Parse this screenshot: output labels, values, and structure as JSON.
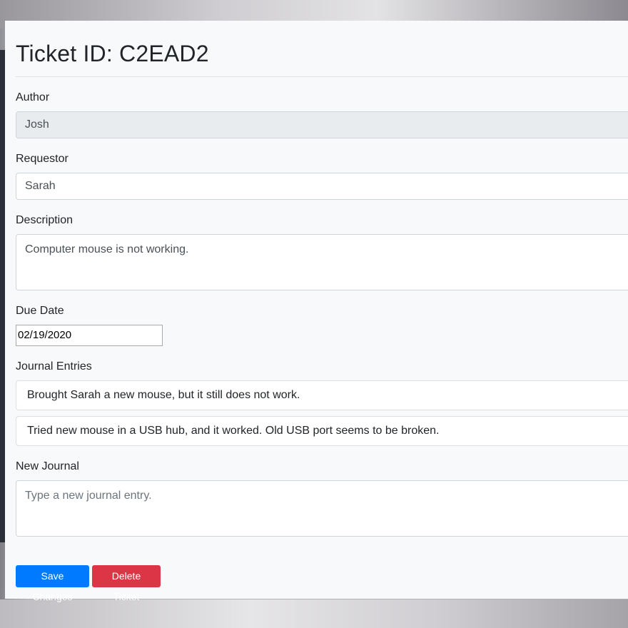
{
  "ticket": {
    "title": "Ticket ID: C2EAD2"
  },
  "form": {
    "author": {
      "label": "Author",
      "value": "Josh"
    },
    "requestor": {
      "label": "Requestor",
      "value": "Sarah"
    },
    "description": {
      "label": "Description",
      "value": "Computer mouse is not working."
    },
    "due_date": {
      "label": "Due Date",
      "value": "02/19/2020"
    },
    "journal_entries": {
      "label": "Journal Entries",
      "items": [
        "Brought Sarah a new mouse, but it still does not work.",
        "Tried new mouse in a USB hub, and it worked. Old USB port seems to be broken."
      ]
    },
    "new_journal": {
      "label": "New Journal",
      "placeholder": "Type a new journal entry."
    }
  },
  "actions": {
    "save_label": "Save Changes",
    "delete_label": "Delete Ticket"
  },
  "colors": {
    "primary": "#007bff",
    "danger": "#dc3545",
    "card_background": "#f8f9fa",
    "readonly_background": "#e9ecef"
  }
}
